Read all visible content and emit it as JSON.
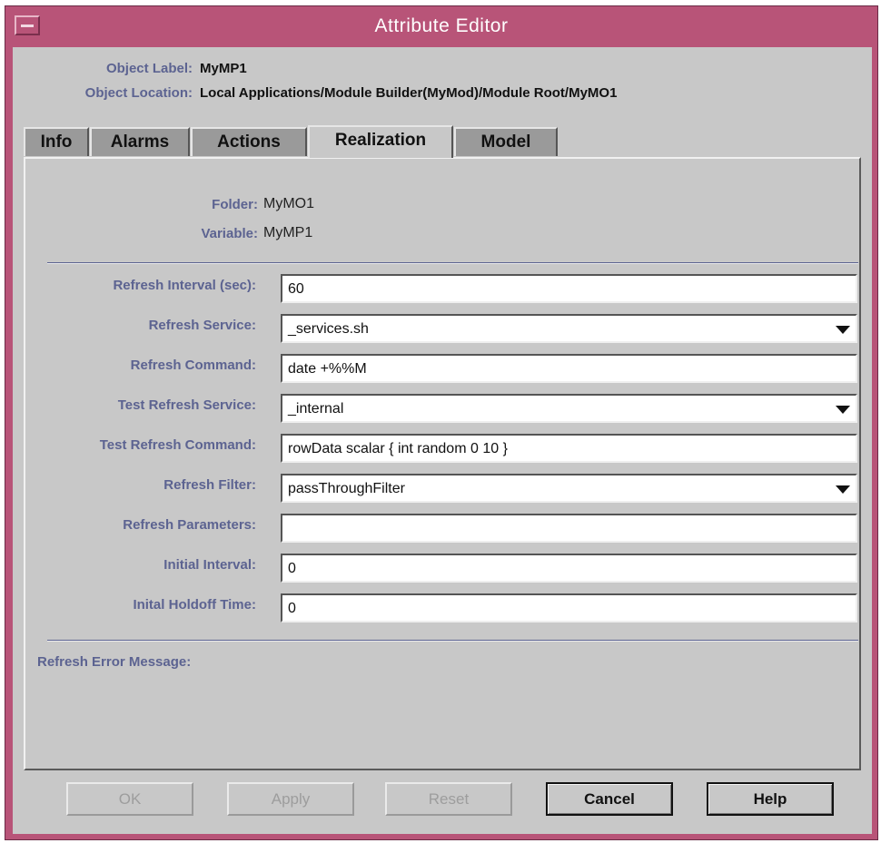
{
  "window": {
    "title": "Attribute Editor",
    "accent_color": "#b85478",
    "label_color": "#5c6391"
  },
  "header": {
    "object_label_caption": "Object Label:",
    "object_label_value": "MyMP1",
    "object_location_caption": "Object Location:",
    "object_location_value": "Local Applications/Module Builder(MyMod)/Module Root/MyMO1"
  },
  "tabs": [
    {
      "label": "Info",
      "active": false
    },
    {
      "label": "Alarms",
      "active": false
    },
    {
      "label": "Actions",
      "active": false
    },
    {
      "label": "Realization",
      "active": true
    },
    {
      "label": "Model",
      "active": false
    }
  ],
  "info": {
    "folder_caption": "Folder:",
    "folder_value": "MyMO1",
    "variable_caption": "Variable:",
    "variable_value": "MyMP1"
  },
  "form": {
    "refresh_interval_label": "Refresh Interval (sec):",
    "refresh_interval_value": "60",
    "refresh_service_label": "Refresh Service:",
    "refresh_service_value": "_services.sh",
    "refresh_command_label": "Refresh Command:",
    "refresh_command_value": "date +%%M",
    "test_refresh_service_label": "Test Refresh Service:",
    "test_refresh_service_value": "_internal",
    "test_refresh_command_label": "Test Refresh Command:",
    "test_refresh_command_value": "rowData scalar { int random 0 10 }",
    "refresh_filter_label": "Refresh Filter:",
    "refresh_filter_value": "passThroughFilter",
    "refresh_parameters_label": "Refresh Parameters:",
    "refresh_parameters_value": "",
    "initial_interval_label": "Initial Interval:",
    "initial_interval_value": "0",
    "initial_holdoff_label": "Inital Holdoff Time:",
    "initial_holdoff_value": "0",
    "refresh_error_label": "Refresh Error Message:"
  },
  "buttons": {
    "ok": "OK",
    "apply": "Apply",
    "reset": "Reset",
    "cancel": "Cancel",
    "help": "Help"
  }
}
